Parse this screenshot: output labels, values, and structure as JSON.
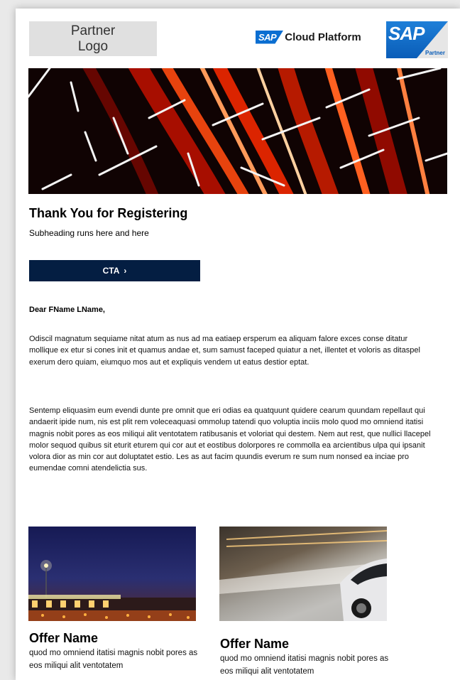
{
  "header": {
    "partner_logo_line1": "Partner",
    "partner_logo_line2": "Logo",
    "sap_mark": "SAP",
    "platform_name": "Cloud Platform",
    "sap_partner_mark": "SAP",
    "sap_partner_label": "Partner"
  },
  "hero": {
    "image": "light-trails-banner"
  },
  "content": {
    "title": "Thank You for Registering",
    "subtitle": "Subheading runs here and here",
    "cta_label": "CTA",
    "cta_arrow": "›",
    "salutation": "Dear FName LName,",
    "paragraph1": "Odiscil magnatum sequiame nitat atum as nus ad ma eatiaep ersperum ea aliquam falore exces conse ditatur mollique ex etur si cones init et quamus andae et, sum samust faceped quiatur a net, illentet et voloris as ditaspel exerum dero quiam, eiumquo mos aut et expliquis vendem ut eatus destior eptat.",
    "paragraph2": "Sentemp eliquasim eum evendi dunte pre omnit que eri odias ea quatquunt quidere cearum quundam repellaut qui andaerit ipide num, nis est plit rem voleceaquasi ommolup tatendi quo voluptia inciis molo quod mo omniend itatisi magnis nobit pores as eos miliqui alit ventotatem ratibusanis et voloriat qui destem. Nem aut rest, que nullici llacepel molor sequod quibus sit eturit eturem qui cor aut et eostibus dolorpores re commolla ea arcientibus ulpa qui ipsanit volora dior as min cor aut doluptatet estio. Les as aut facim quundis everum re sum num nonsed ea inciae pro eumendae comni atendelictia sus."
  },
  "offers": [
    {
      "title": "Offer Name",
      "text": "quod mo omniend itatisi magnis nobit pores as eos miliqui alit ventotatem",
      "image": "toll-plaza-night"
    },
    {
      "title": "Offer Name",
      "text": "quod mo omniend itatisi magnis nobit pores as eos miliqui alit ventotatem",
      "image": "car-motion-tunnel"
    }
  ],
  "colors": {
    "cta_bg": "#041e42",
    "sap_blue": "#0a6ed1",
    "page_bg": "#e9e9e9"
  }
}
